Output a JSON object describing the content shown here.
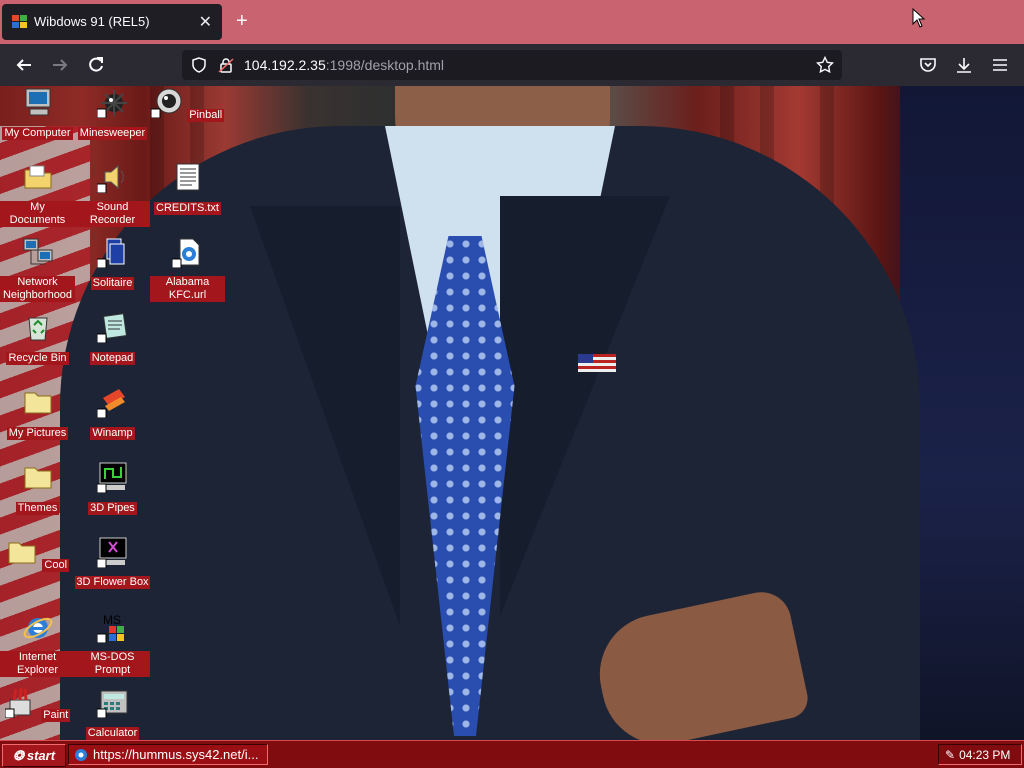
{
  "browser": {
    "tab_title": "Wibdows 91 (REL5)",
    "new_tab_label": "+",
    "url_host": "104.192.2.35",
    "url_rest": ":1998/desktop.html"
  },
  "desktop": {
    "icons": [
      {
        "label": "My Computer",
        "icon": "computer-icon"
      },
      {
        "label": "Minesweeper",
        "icon": "mine-icon"
      },
      {
        "label": "Pinball",
        "icon": "pinball-icon"
      },
      {
        "label": "My Documents",
        "icon": "folder-icon"
      },
      {
        "label": "Sound Recorder",
        "icon": "speaker-icon"
      },
      {
        "label": "CREDITS.txt",
        "icon": "text-file-icon"
      },
      {
        "label": "Network Neighborhood",
        "icon": "network-icon"
      },
      {
        "label": "Solitaire",
        "icon": "cards-icon"
      },
      {
        "label": "Alabama KFC.url",
        "icon": "url-icon"
      },
      {
        "label": "Recycle Bin",
        "icon": "recycle-bin-icon"
      },
      {
        "label": "Notepad",
        "icon": "notepad-icon"
      },
      {
        "label": "My Pictures",
        "icon": "folder-icon"
      },
      {
        "label": "Winamp",
        "icon": "winamp-icon"
      },
      {
        "label": "Themes",
        "icon": "folder-icon"
      },
      {
        "label": "3D Pipes",
        "icon": "screensaver-icon"
      },
      {
        "label": "Cool",
        "icon": "folder-icon"
      },
      {
        "label": "3D Flower Box",
        "icon": "screensaver-icon"
      },
      {
        "label": "Internet Explorer",
        "icon": "ie-icon"
      },
      {
        "label": "MS-DOS Prompt",
        "icon": "msdos-icon"
      },
      {
        "label": "Paint",
        "icon": "paint-icon"
      },
      {
        "label": "Calculator",
        "icon": "calculator-icon"
      }
    ]
  },
  "taskbar": {
    "start_label": "start",
    "task_label": "https://hummus.sys42.net/i...",
    "clock": "04:23 PM"
  },
  "colors": {
    "tab_strip": "#c9636f",
    "taskbar": "#800c10",
    "label_bg": "#a3161b"
  }
}
